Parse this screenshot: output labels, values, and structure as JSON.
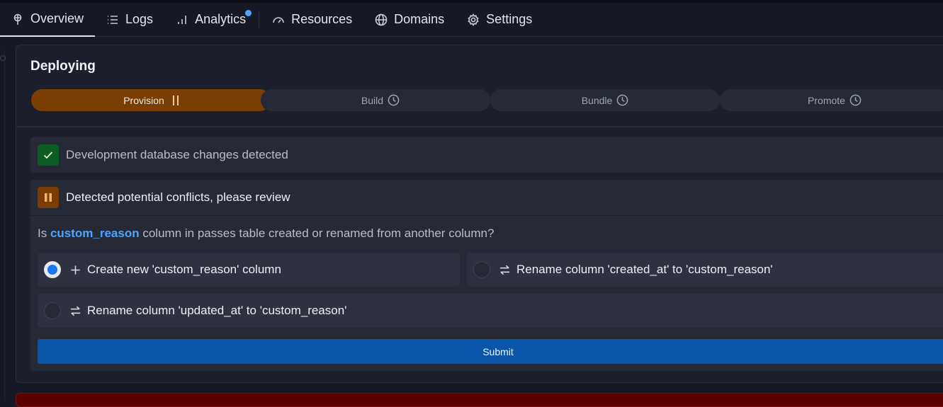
{
  "nav": {
    "tabs": [
      {
        "label": "Overview",
        "icon": "pin-icon",
        "active": true
      },
      {
        "label": "Logs",
        "icon": "list-icon"
      },
      {
        "label": "Analytics",
        "icon": "bar-chart-icon",
        "has_notification": true
      },
      {
        "label": "Resources",
        "icon": "gauge-icon"
      },
      {
        "label": "Domains",
        "icon": "globe-icon"
      },
      {
        "label": "Settings",
        "icon": "gear-icon"
      }
    ]
  },
  "deploy": {
    "title": "Deploying",
    "steps": [
      {
        "label": "Provision",
        "state": "paused"
      },
      {
        "label": "Build",
        "state": "pending"
      },
      {
        "label": "Bundle",
        "state": "pending"
      },
      {
        "label": "Promote",
        "state": "pending"
      }
    ],
    "checks": {
      "db_changes": "Development database changes detected",
      "conflicts": "Detected potential conflicts, please review"
    },
    "question": {
      "prefix": "Is ",
      "column": "custom_reason",
      "suffix": " column in passes table created or renamed from another column?"
    },
    "options": [
      {
        "label": "Create new 'custom_reason' column",
        "selected": true
      },
      {
        "label": "Rename column 'created_at' to 'custom_reason'",
        "selected": false
      },
      {
        "label": "Rename column 'updated_at' to 'custom_reason'",
        "selected": false
      }
    ],
    "submit_label": "Submit"
  },
  "colors": {
    "accent": "#4fa4ff",
    "provision_active": "#7a3e04",
    "success": "#0d5c23",
    "submit": "#0955aa",
    "error_bar": "#5b0000"
  }
}
